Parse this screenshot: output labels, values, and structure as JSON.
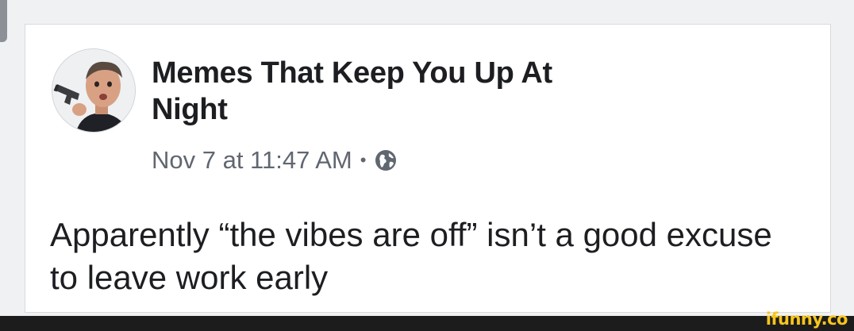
{
  "post": {
    "author": "Memes That Keep You Up At Night",
    "date": "Nov 7 at 11:47 AM",
    "separator": "•",
    "privacy_icon": "globe-icon",
    "text": "Apparently “the vibes are off” isn’t a good excuse to leave work early"
  },
  "watermark": {
    "text": "ifunny.co"
  },
  "colors": {
    "author_text": "#1c1e21",
    "meta_text": "#606770",
    "card_bg": "#ffffff",
    "page_bg": "#f0f1f3",
    "watermark": "#f7c51e"
  }
}
